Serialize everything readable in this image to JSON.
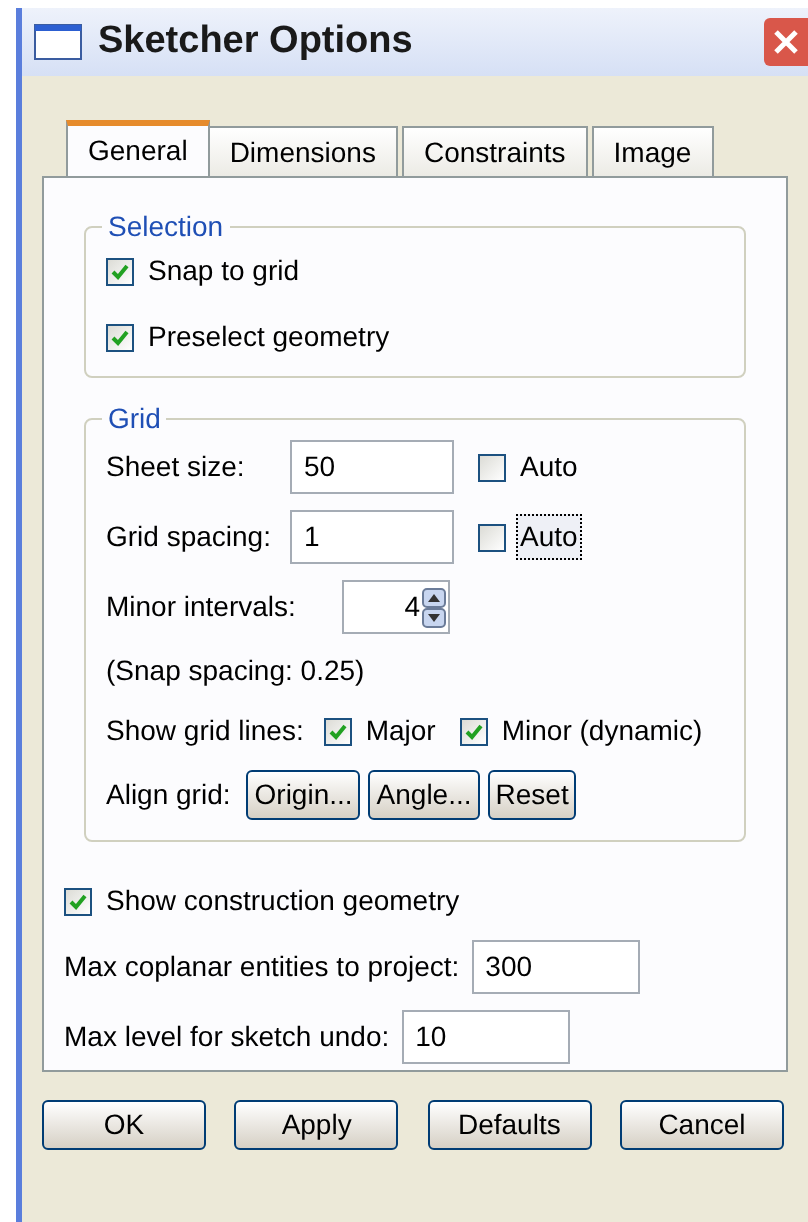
{
  "window": {
    "title": "Sketcher Options"
  },
  "tabs": [
    {
      "label": "General",
      "selected": true
    },
    {
      "label": "Dimensions",
      "selected": false
    },
    {
      "label": "Constraints",
      "selected": false
    },
    {
      "label": "Image",
      "selected": false
    }
  ],
  "selection": {
    "title": "Selection",
    "options": [
      {
        "label": "Snap to grid",
        "checked": true
      },
      {
        "label": "Preselect geometry",
        "checked": true
      }
    ]
  },
  "grid": {
    "title": "Grid",
    "size_fields": [
      {
        "label": "Sheet size:",
        "value": "50",
        "auto_label": "Auto",
        "auto_checked": false,
        "auto_focused": false
      },
      {
        "label": "Grid spacing:",
        "value": "1",
        "auto_label": "Auto",
        "auto_checked": false,
        "auto_focused": true
      }
    ],
    "minor_intervals": {
      "label": "Minor intervals:",
      "value": "4"
    },
    "snap_note": "(Snap spacing: 0.25)",
    "show_grid_lines": {
      "label": "Show grid lines:",
      "options": [
        {
          "label": "Major",
          "checked": true
        },
        {
          "label": "Minor (dynamic)",
          "checked": true
        }
      ]
    },
    "align_grid": {
      "label": "Align grid:",
      "buttons": [
        "Origin...",
        "Angle...",
        "Reset"
      ]
    }
  },
  "show_construction": {
    "label": "Show construction geometry",
    "checked": true
  },
  "fields": [
    {
      "label": "Max coplanar entities to project:",
      "value": "300"
    },
    {
      "label": "Max level for sketch undo:",
      "value": "10"
    }
  ],
  "buttons": [
    "OK",
    "Apply",
    "Defaults",
    "Cancel"
  ]
}
